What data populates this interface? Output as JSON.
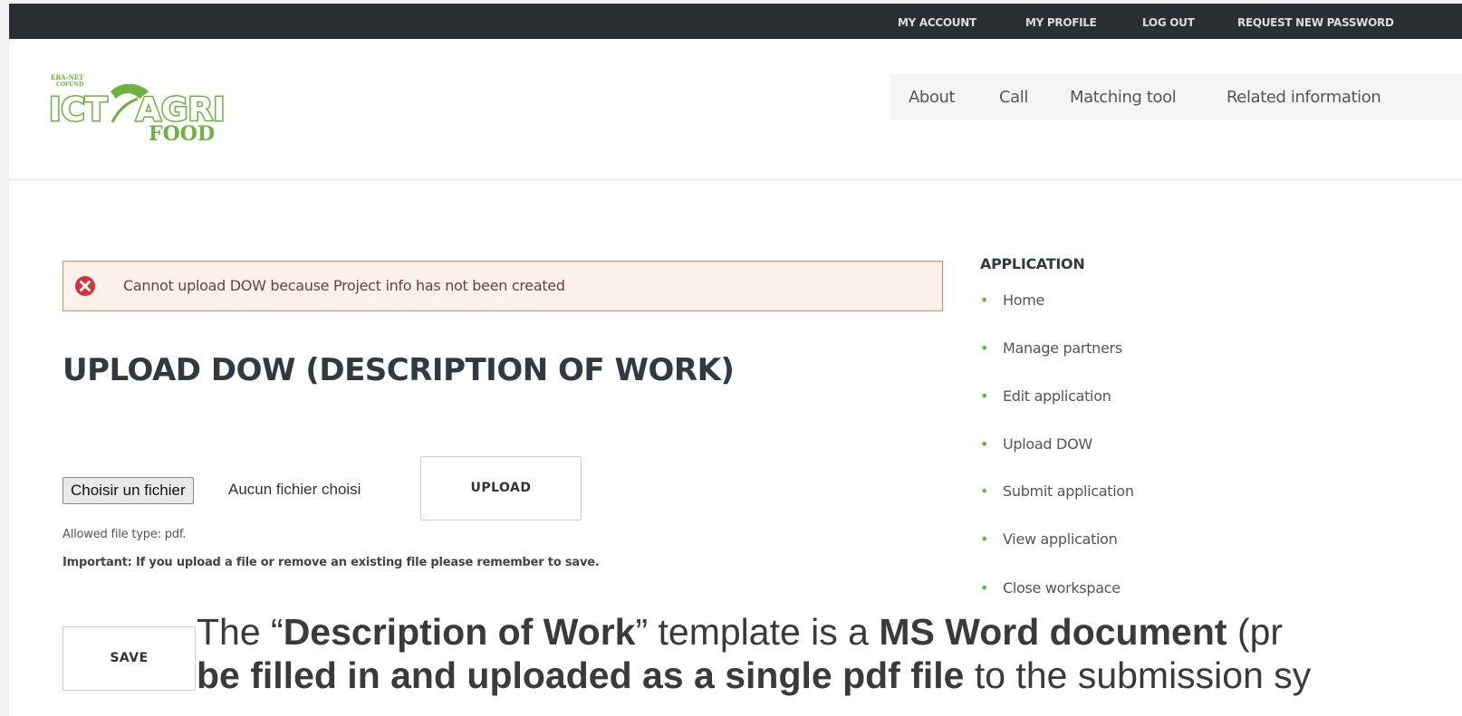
{
  "topbar": {
    "links": [
      "MY ACCOUNT",
      "MY PROFILE",
      "LOG OUT",
      "REQUEST NEW PASSWORD"
    ]
  },
  "logo": {
    "line1": "ERA-NET",
    "line2": "COFUND",
    "word1": "ICT",
    "word2": "AGRI",
    "word3": "FOOD",
    "color": "#6cb33e"
  },
  "mainnav": {
    "items": [
      "About",
      "Call",
      "Matching tool",
      "Related information"
    ]
  },
  "error": {
    "message": "Cannot upload DOW because Project info has not been created",
    "color": "#d9303a"
  },
  "page": {
    "title": "UPLOAD DOW (DESCRIPTION OF WORK)"
  },
  "upload": {
    "choose_label": "Choisir un fichier",
    "no_file_text": "Aucun fichier choisi",
    "upload_label": "UPLOAD",
    "allowed_types": "Allowed file type: pdf.",
    "important_note": "Important: If you upload a file or remove an existing file please remember to save.",
    "save_label": "SAVE"
  },
  "sidebar": {
    "title": "APPLICATION",
    "items": [
      "Home",
      "Manage partners",
      "Edit application",
      "Upload DOW",
      "Submit application",
      "View application",
      "Close workspace"
    ]
  },
  "overlay": {
    "line1": {
      "p1": "The “",
      "b1": "Description of Work",
      "p2": "” template is a ",
      "b2": "MS Word document",
      "p3": " (pr"
    },
    "line2": {
      "b1": "be filled in and uploaded as a single pdf file",
      "p1": " to the submission sy"
    }
  }
}
